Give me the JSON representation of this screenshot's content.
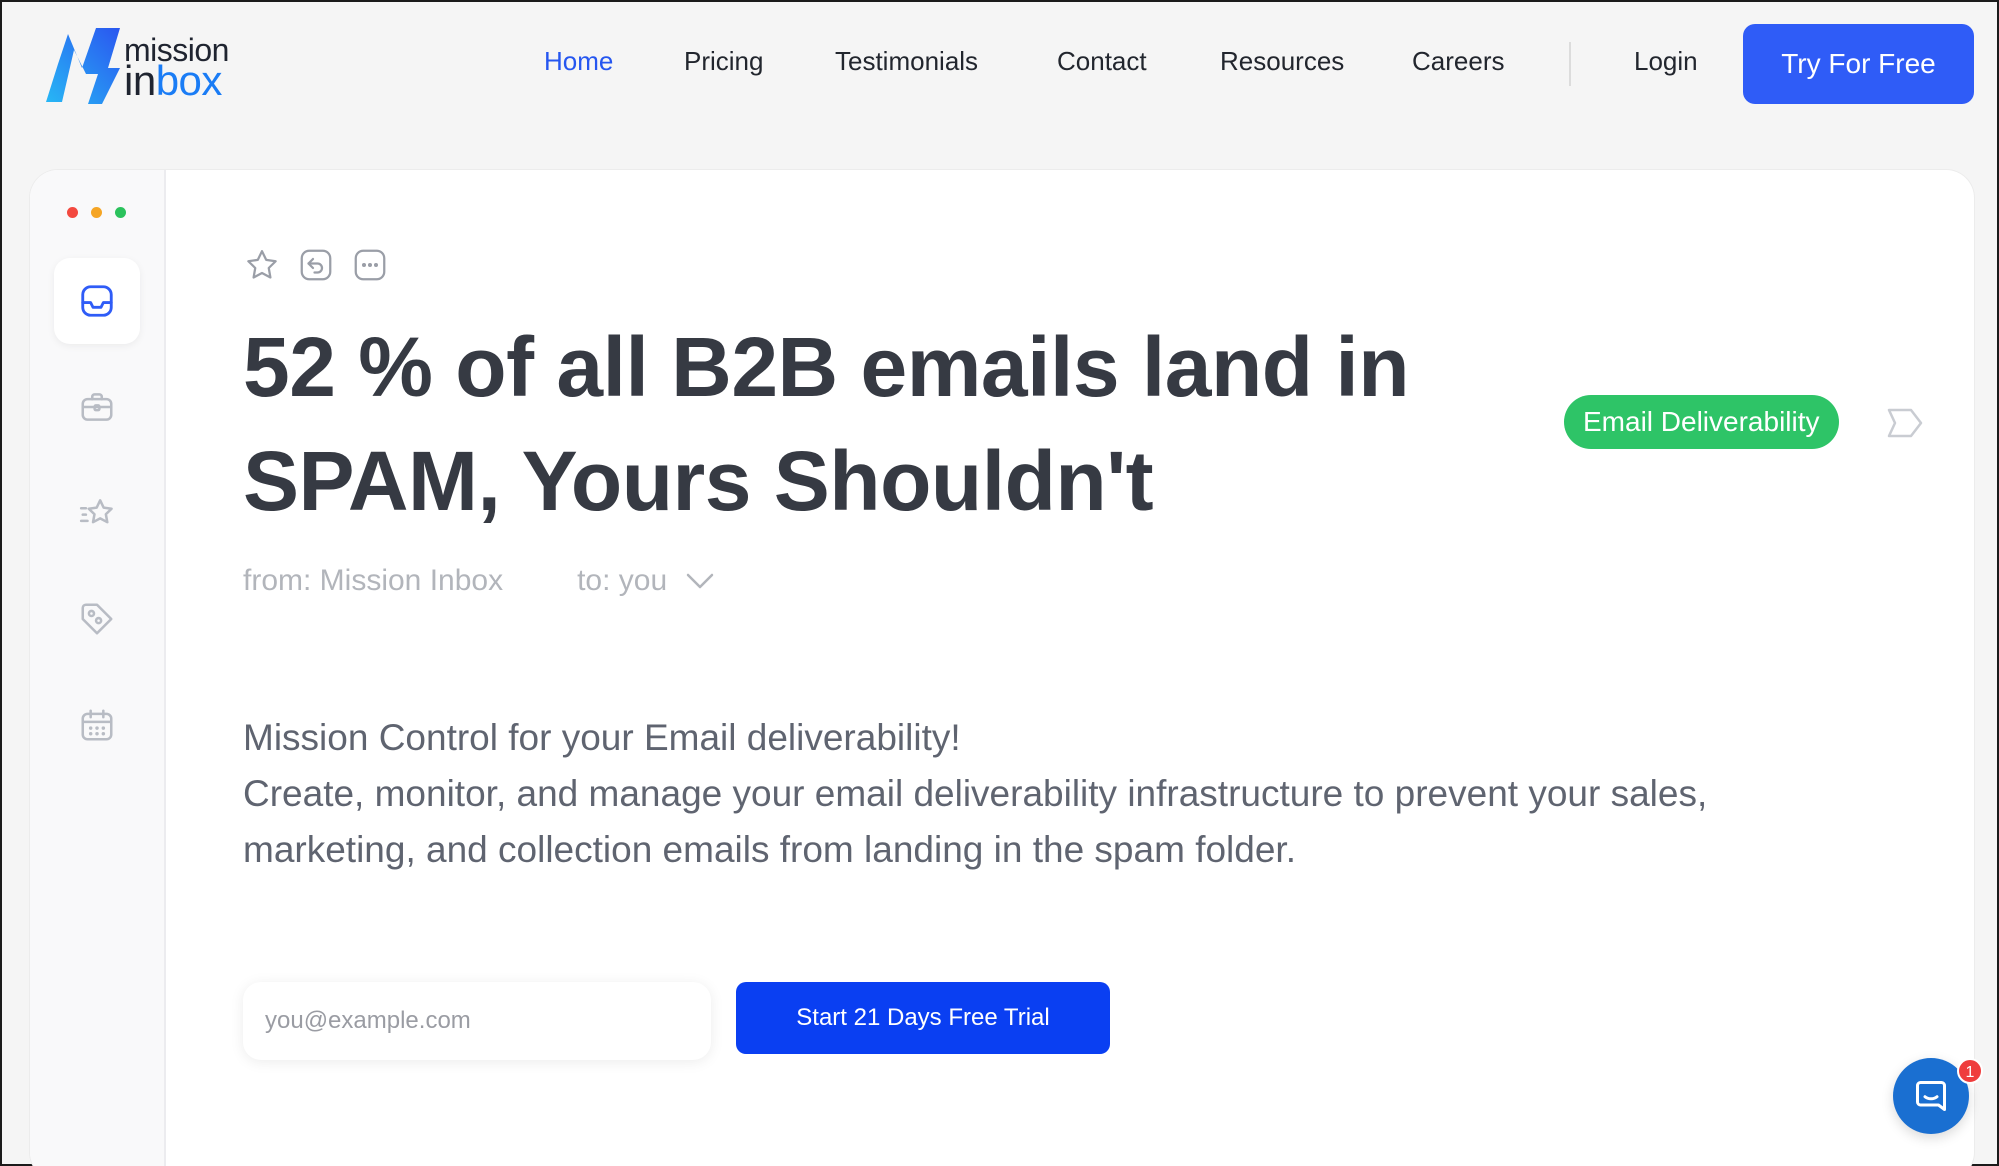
{
  "brand": {
    "line1": "mission",
    "line2_in": "in",
    "line2_box": "box",
    "accent_color": "#2f5cf7",
    "logo_blue": "#1a7cf5"
  },
  "nav": {
    "items": [
      {
        "label": "Home",
        "active": true
      },
      {
        "label": "Pricing"
      },
      {
        "label": "Testimonials"
      },
      {
        "label": "Contact"
      },
      {
        "label": "Resources"
      },
      {
        "label": "Careers"
      }
    ],
    "login": "Login",
    "cta": "Try For Free"
  },
  "sidebar": {
    "icons": [
      "inbox-icon",
      "briefcase-icon",
      "starred-icon",
      "tag-icon",
      "calendar-icon"
    ],
    "active_index": 0
  },
  "email": {
    "toolbar_icons": [
      "star-icon",
      "reply-icon",
      "more-icon"
    ],
    "headline_line1": "52 % of all B2B emails land in",
    "headline_line2": "SPAM, Yours Shouldn't",
    "tag": "Email Deliverability",
    "tag_color": "#2ec467",
    "from": "from: Mission Inbox",
    "to": "to: you",
    "body_line1": "Mission Control for your Email deliverability!",
    "body_line2": "Create, monitor, and manage your email deliverability infrastructure to prevent your sales,",
    "body_line3": "marketing, and collection emails from landing in the spam folder."
  },
  "signup": {
    "placeholder": "you@example.com",
    "button": "Start 21 Days Free Trial"
  },
  "chat": {
    "badge": "1"
  }
}
